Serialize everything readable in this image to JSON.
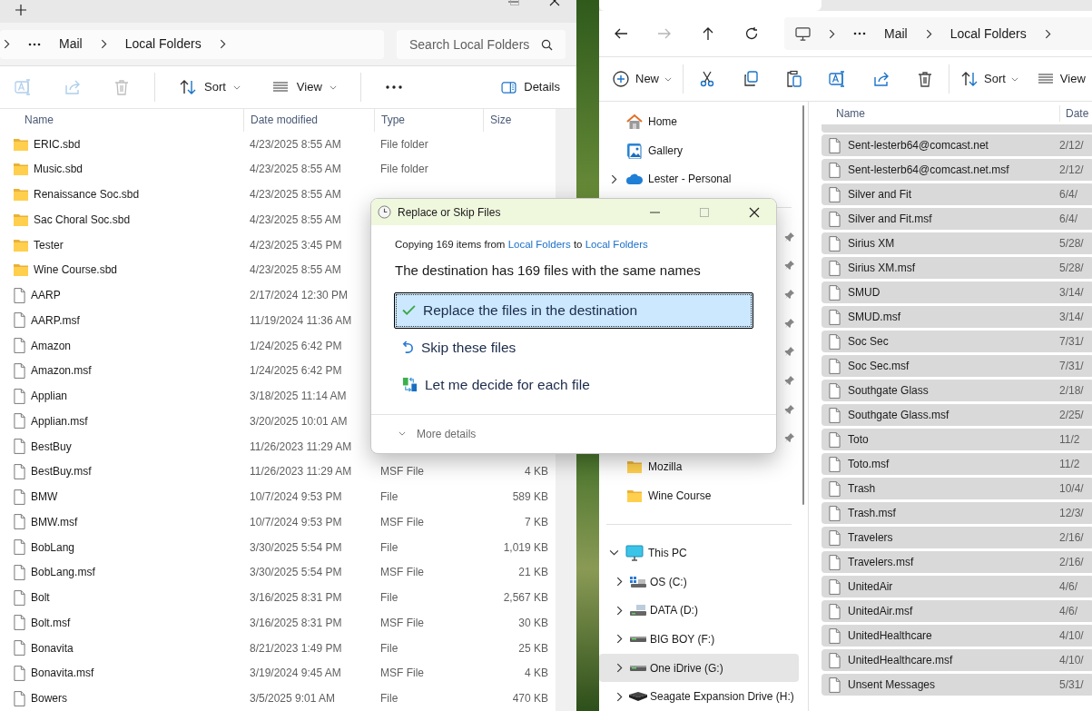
{
  "left_window": {
    "crumbs": [
      "Mail",
      "Local Folders"
    ],
    "search": {
      "placeholder": "Search Local Folders"
    },
    "toolbar": [
      {
        "kind": "rename",
        "disabled": true
      },
      {
        "kind": "share",
        "disabled": true
      },
      {
        "kind": "delete",
        "disabled": true
      },
      {
        "kind": "sort",
        "label": "Sort",
        "disabled": false
      },
      {
        "kind": "view",
        "label": "View",
        "disabled": false
      },
      {
        "kind": "more",
        "disabled": false
      }
    ],
    "details_button": {
      "label": "Details"
    },
    "columns": [
      "Name",
      "Date modified",
      "Type",
      "Size"
    ],
    "rows": [
      {
        "kind": "folder",
        "name": "ERIC.sbd",
        "date": "4/23/2025 8:55 AM",
        "type": "File folder"
      },
      {
        "kind": "folder",
        "name": "Music.sbd",
        "date": "4/23/2025 8:55 AM",
        "type": "File folder"
      },
      {
        "kind": "folder",
        "name": "Renaissance Soc.sbd",
        "date": "4/23/2025 8:55 AM"
      },
      {
        "kind": "folder",
        "name": "Sac Choral Soc.sbd",
        "date": "4/23/2025 8:55 AM"
      },
      {
        "kind": "folder",
        "name": "Tester",
        "date": "4/23/2025 3:45 PM"
      },
      {
        "kind": "folder",
        "name": "Wine Course.sbd",
        "date": "4/23/2025 8:55 AM"
      },
      {
        "kind": "file",
        "name": "AARP",
        "date": "2/17/2024 12:30 PM"
      },
      {
        "kind": "file",
        "name": "AARP.msf",
        "date": "11/19/2024 11:36 AM"
      },
      {
        "kind": "file",
        "name": "Amazon",
        "date": "1/24/2025 6:42 PM"
      },
      {
        "kind": "file",
        "name": "Amazon.msf",
        "date": "1/24/2025 6:42 PM"
      },
      {
        "kind": "file",
        "name": "Applian",
        "date": "3/18/2025 11:14 AM"
      },
      {
        "kind": "file",
        "name": "Applian.msf",
        "date": "3/20/2025 10:01 AM"
      },
      {
        "kind": "file",
        "name": "BestBuy",
        "date": "11/26/2023 11:29 AM"
      },
      {
        "kind": "file",
        "name": "BestBuy.msf",
        "date": "11/26/2023 11:29 AM",
        "type": "MSF File",
        "size": "4 KB"
      },
      {
        "kind": "file",
        "name": "BMW",
        "date": "10/7/2024 9:53 PM",
        "type": "File",
        "size": "589 KB"
      },
      {
        "kind": "file",
        "name": "BMW.msf",
        "date": "10/7/2024 9:53 PM",
        "type": "MSF File",
        "size": "7 KB"
      },
      {
        "kind": "file",
        "name": "BobLang",
        "date": "3/30/2025 5:54 PM",
        "type": "File",
        "size": "1,019 KB"
      },
      {
        "kind": "file",
        "name": "BobLang.msf",
        "date": "3/30/2025 5:54 PM",
        "type": "MSF File",
        "size": "21 KB"
      },
      {
        "kind": "file",
        "name": "Bolt",
        "date": "3/16/2025 8:31 PM",
        "type": "File",
        "size": "2,567 KB"
      },
      {
        "kind": "file",
        "name": "Bolt.msf",
        "date": "3/16/2025 8:31 PM",
        "type": "MSF File",
        "size": "30 KB"
      },
      {
        "kind": "file",
        "name": "Bonavita",
        "date": "8/21/2023 1:49 PM",
        "type": "File",
        "size": "25 KB"
      },
      {
        "kind": "file",
        "name": "Bonavita.msf",
        "date": "3/19/2024 9:45 AM",
        "type": "MSF File",
        "size": "4 KB"
      },
      {
        "kind": "file",
        "name": "Bowers",
        "date": "3/5/2025 9:01 AM",
        "type": "File",
        "size": "470 KB"
      }
    ]
  },
  "right_window": {
    "nav": [
      {
        "kind": "back",
        "disabled": false
      },
      {
        "kind": "forward",
        "disabled": true
      },
      {
        "kind": "up",
        "disabled": false
      },
      {
        "kind": "refresh",
        "disabled": false
      }
    ],
    "crumbs": [
      "Mail",
      "Local Folders"
    ],
    "toolbar": [
      {
        "kind": "new",
        "label": "New"
      },
      {
        "kind": "cut"
      },
      {
        "kind": "copy"
      },
      {
        "kind": "paste"
      },
      {
        "kind": "rename"
      },
      {
        "kind": "share"
      },
      {
        "kind": "delete"
      },
      {
        "kind": "sort",
        "label": "Sort"
      },
      {
        "kind": "view",
        "label": "View"
      }
    ],
    "sidebar": [
      {
        "kind": "home",
        "label": "Home",
        "selected": false
      },
      {
        "kind": "gallery",
        "label": "Gallery",
        "selected": false
      },
      {
        "kind": "cloud",
        "label": "Lester - Personal",
        "expanded": false,
        "selected": false
      },
      {
        "kind": "divider"
      },
      {
        "kind": "pinned"
      },
      {
        "kind": "pinned"
      },
      {
        "kind": "pinned"
      },
      {
        "kind": "pinned"
      },
      {
        "kind": "pinned"
      },
      {
        "kind": "pinned"
      },
      {
        "kind": "pinned"
      },
      {
        "kind": "pinned"
      },
      {
        "kind": "folder",
        "label": "Mozilla",
        "selected": false
      },
      {
        "kind": "folder",
        "label": "Wine Course",
        "selected": false
      },
      {
        "kind": "divider"
      },
      {
        "kind": "pc",
        "label": "This PC",
        "expanded": true,
        "selected": false,
        "children": [
          {
            "kind": "os_drive",
            "label": "OS (C:)",
            "expanded": false,
            "selected": false
          },
          {
            "kind": "data_drive",
            "label": "DATA (D:)",
            "expanded": false,
            "selected": false
          },
          {
            "kind": "drive",
            "label": "BIG BOY (F:)",
            "expanded": false,
            "selected": false
          },
          {
            "kind": "drive",
            "label": "One iDrive (G:)",
            "expanded": false,
            "selected": true
          },
          {
            "kind": "external_drive",
            "label": "Seagate Expansion Drive (H:)",
            "expanded": false,
            "selected": false
          }
        ]
      }
    ],
    "columns": [
      "Name",
      "Date"
    ],
    "rows": [
      {
        "name": "Sent-lesterb64@comcast.net",
        "date": "2/12/",
        "selected": true
      },
      {
        "name": "Sent-lesterb64@comcast.net.msf",
        "date": "2/12/",
        "selected": true
      },
      {
        "name": "Silver and Fit",
        "date": "6/4/",
        "selected": true
      },
      {
        "name": "Silver and Fit.msf",
        "date": "6/4/",
        "selected": true
      },
      {
        "name": "Sirius XM",
        "date": "5/28/",
        "selected": true
      },
      {
        "name": "Sirius XM.msf",
        "date": "5/28/",
        "selected": true
      },
      {
        "name": "SMUD",
        "date": "3/14/",
        "selected": true
      },
      {
        "name": "SMUD.msf",
        "date": "3/14/",
        "selected": true
      },
      {
        "name": "Soc Sec",
        "date": "7/31/",
        "selected": true
      },
      {
        "name": "Soc Sec.msf",
        "date": "7/31/",
        "selected": true
      },
      {
        "name": "Southgate Glass",
        "date": "2/18/",
        "selected": true
      },
      {
        "name": "Southgate Glass.msf",
        "date": "2/25/",
        "selected": true
      },
      {
        "name": "Toto",
        "date": "11/2",
        "selected": true
      },
      {
        "name": "Toto.msf",
        "date": "11/2",
        "selected": true
      },
      {
        "name": "Trash",
        "date": "10/4/",
        "selected": true
      },
      {
        "name": "Trash.msf",
        "date": "12/3/",
        "selected": true
      },
      {
        "name": "Travelers",
        "date": "2/16/",
        "selected": true
      },
      {
        "name": "Travelers.msf",
        "date": "2/16/",
        "selected": true
      },
      {
        "name": "UnitedAir",
        "date": "4/6/",
        "selected": true
      },
      {
        "name": "UnitedAir.msf",
        "date": "4/6/",
        "selected": true
      },
      {
        "name": "UnitedHealthcare",
        "date": "4/10/",
        "selected": true
      },
      {
        "name": "UnitedHealthcare.msf",
        "date": "4/10/",
        "selected": true
      },
      {
        "name": "Unsent Messages",
        "date": "5/31/",
        "selected": true
      }
    ]
  },
  "dialog": {
    "title": "Replace or Skip Files",
    "copying": {
      "prefix": "Copying 169 items from",
      "source": "Local Folders",
      "middle": "to",
      "target": "Local Folders"
    },
    "heading": "The destination has 169 files with the same names",
    "options": [
      {
        "kind": "replace",
        "label": "Replace the files in the destination",
        "selected": true
      },
      {
        "kind": "skip",
        "label": "Skip these files",
        "selected": false
      },
      {
        "kind": "decide",
        "label": "Let me decide for each file",
        "selected": false
      }
    ],
    "more_details": "More details"
  }
}
